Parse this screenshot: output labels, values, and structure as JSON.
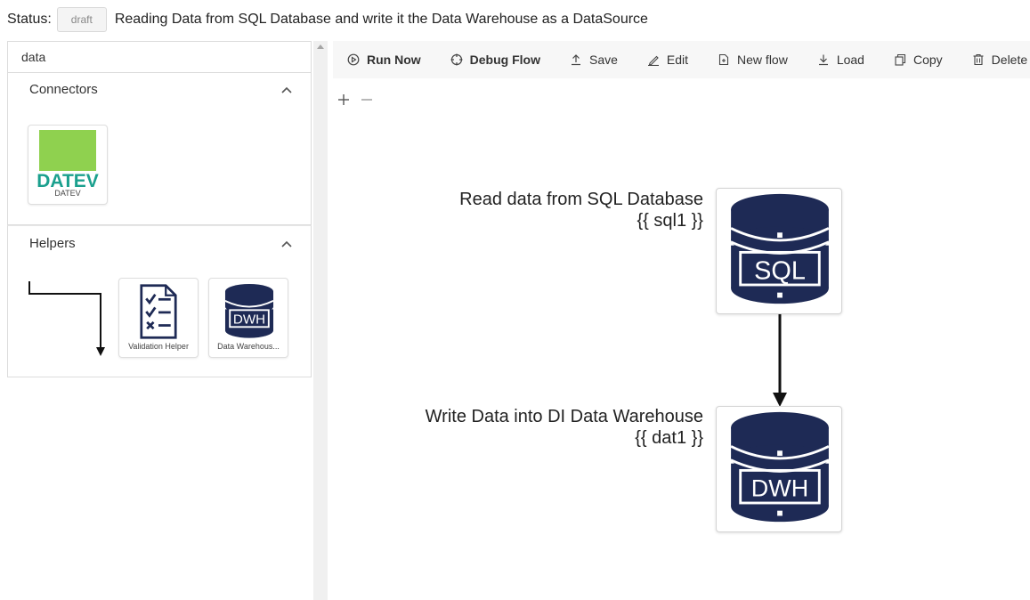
{
  "header": {
    "status_label": "Status:",
    "status_value": "draft",
    "flow_title": "Reading Data from SQL Database and write it the Data Warehouse as a DataSource"
  },
  "sidebar": {
    "search_value": "data",
    "sections": [
      {
        "title": "Connectors",
        "items": [
          {
            "label": "DATEV",
            "logo_text": "DATEV",
            "icon": "datev-logo"
          }
        ]
      },
      {
        "title": "Helpers",
        "items": [
          {
            "label": "",
            "icon": "flow-arrow-icon"
          },
          {
            "label": "Validation Helper",
            "icon": "checklist-icon"
          },
          {
            "label": "Data Warehous...",
            "icon": "dwh-database-icon",
            "icon_text": "DWH"
          }
        ]
      }
    ]
  },
  "toolbar": {
    "buttons": [
      {
        "label": "Run Now",
        "icon": "play-icon"
      },
      {
        "label": "Debug Flow",
        "icon": "debug-icon"
      },
      {
        "label": "Save",
        "icon": "upload-icon"
      },
      {
        "label": "Edit",
        "icon": "pencil-icon"
      },
      {
        "label": "New flow",
        "icon": "new-file-icon"
      },
      {
        "label": "Load",
        "icon": "download-icon"
      },
      {
        "label": "Copy",
        "icon": "copy-icon"
      },
      {
        "label": "Delete",
        "icon": "trash-icon"
      }
    ]
  },
  "canvas": {
    "nodes": [
      {
        "title": "Read data from SQL Database",
        "var": "{{ sql1 }}",
        "icon": "sql-database-icon",
        "icon_text": "SQL"
      },
      {
        "title": "Write Data into DI Data Warehouse",
        "var": "{{ dat1 }}",
        "icon": "dwh-database-icon",
        "icon_text": "DWH"
      }
    ]
  },
  "colors": {
    "db_icon": "#1e2a55",
    "datev_green": "#8fd14f",
    "datev_teal": "#1ba08e",
    "toolbar_bg": "#f7f7f7"
  }
}
